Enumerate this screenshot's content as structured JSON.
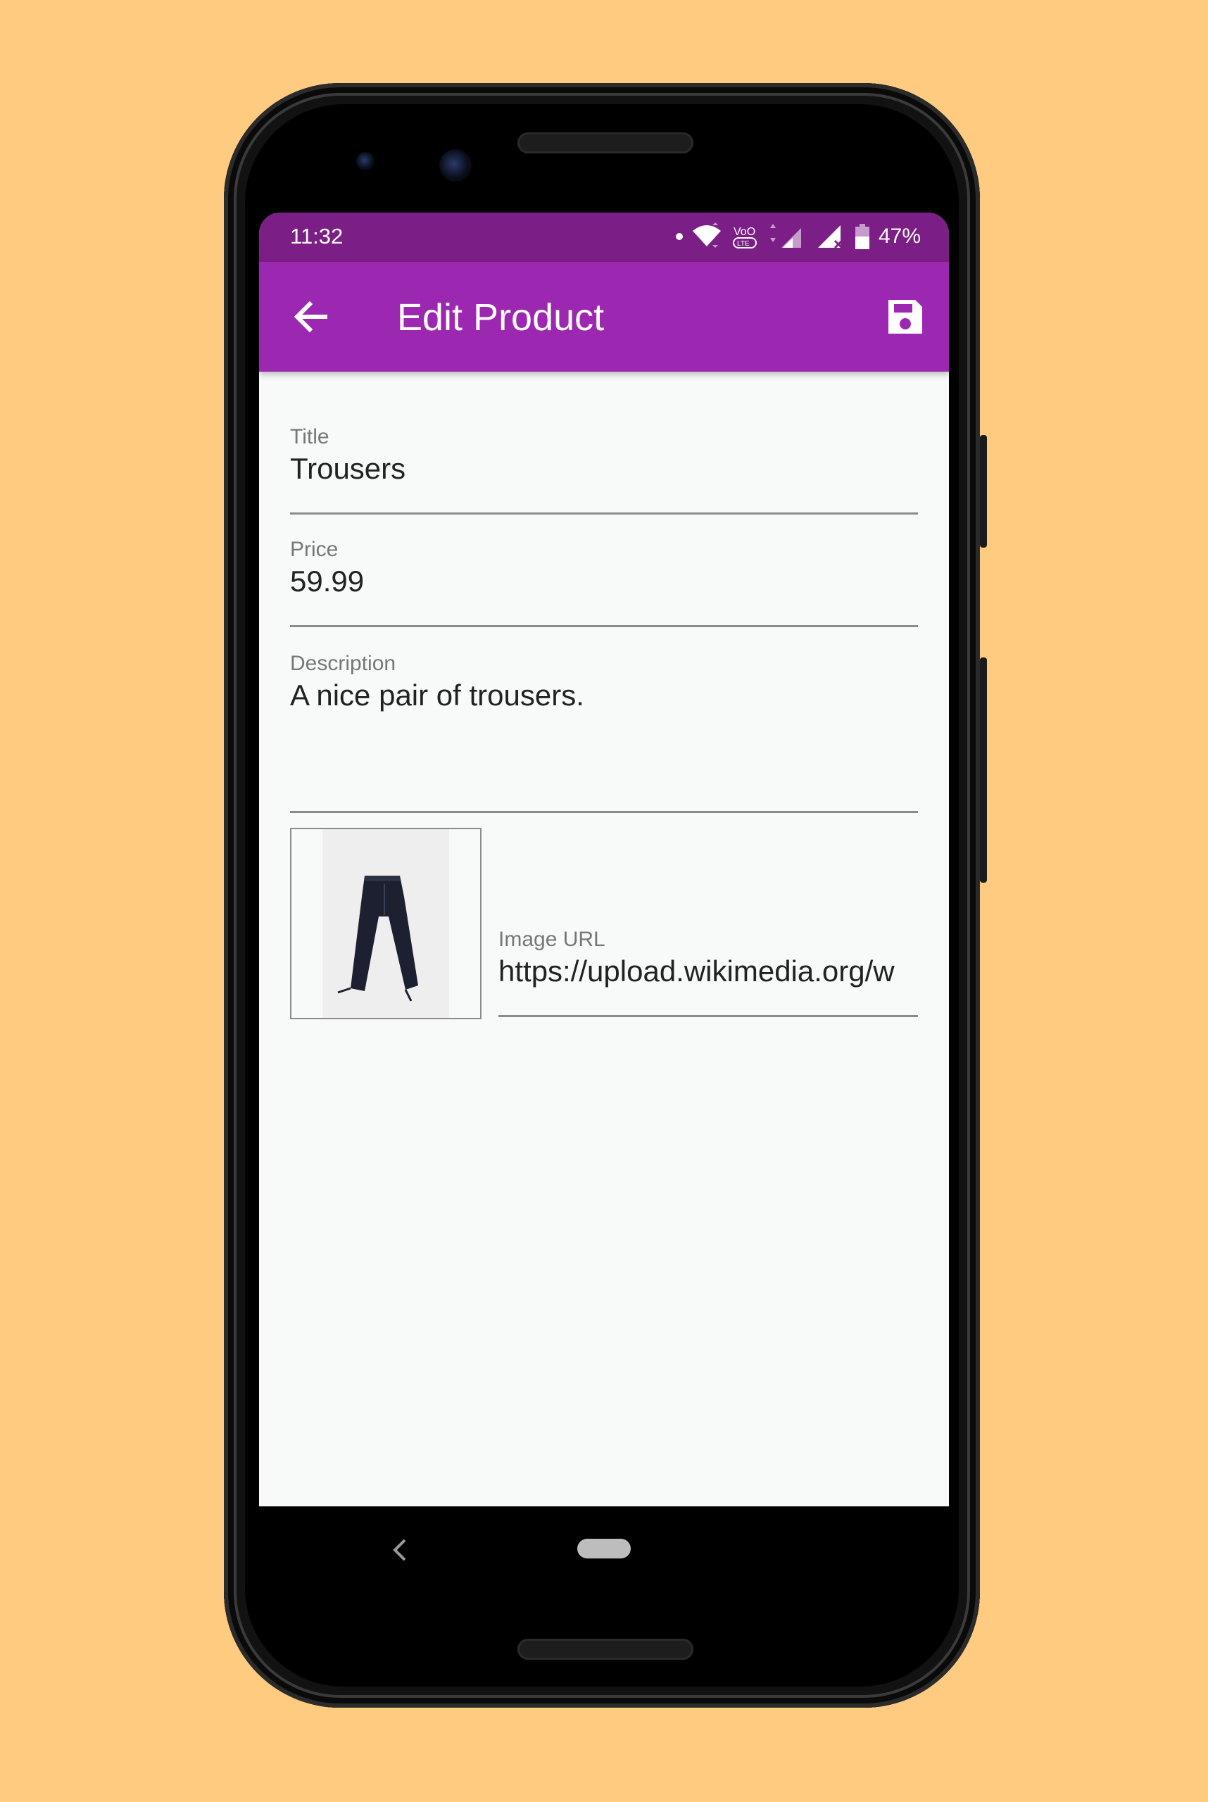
{
  "status_bar": {
    "time": "11:32",
    "battery": "47%",
    "icons": [
      "notification-dot-icon",
      "wifi-icon",
      "volte-icon",
      "signal-icon",
      "signal-no-service-icon",
      "battery-icon"
    ]
  },
  "app_bar": {
    "title": "Edit Product",
    "back_icon": "arrow-back-icon",
    "save_icon": "save-icon",
    "color": "#9C27B0",
    "status_color": "#7B1F86"
  },
  "form": {
    "title": {
      "label": "Title",
      "value": "Trousers"
    },
    "price": {
      "label": "Price",
      "value": "59.99"
    },
    "description": {
      "label": "Description",
      "value": "A nice pair of trousers."
    },
    "image_url": {
      "label": "Image URL",
      "value": "https://upload.wikimedia.org/w"
    }
  },
  "preview": {
    "icon": "trousers-image"
  },
  "nav": {
    "back_icon": "nav-back-icon",
    "home_icon": "nav-home-pill"
  },
  "colors": {
    "background": "#FFCB80",
    "screen": "#F8F9F9"
  }
}
